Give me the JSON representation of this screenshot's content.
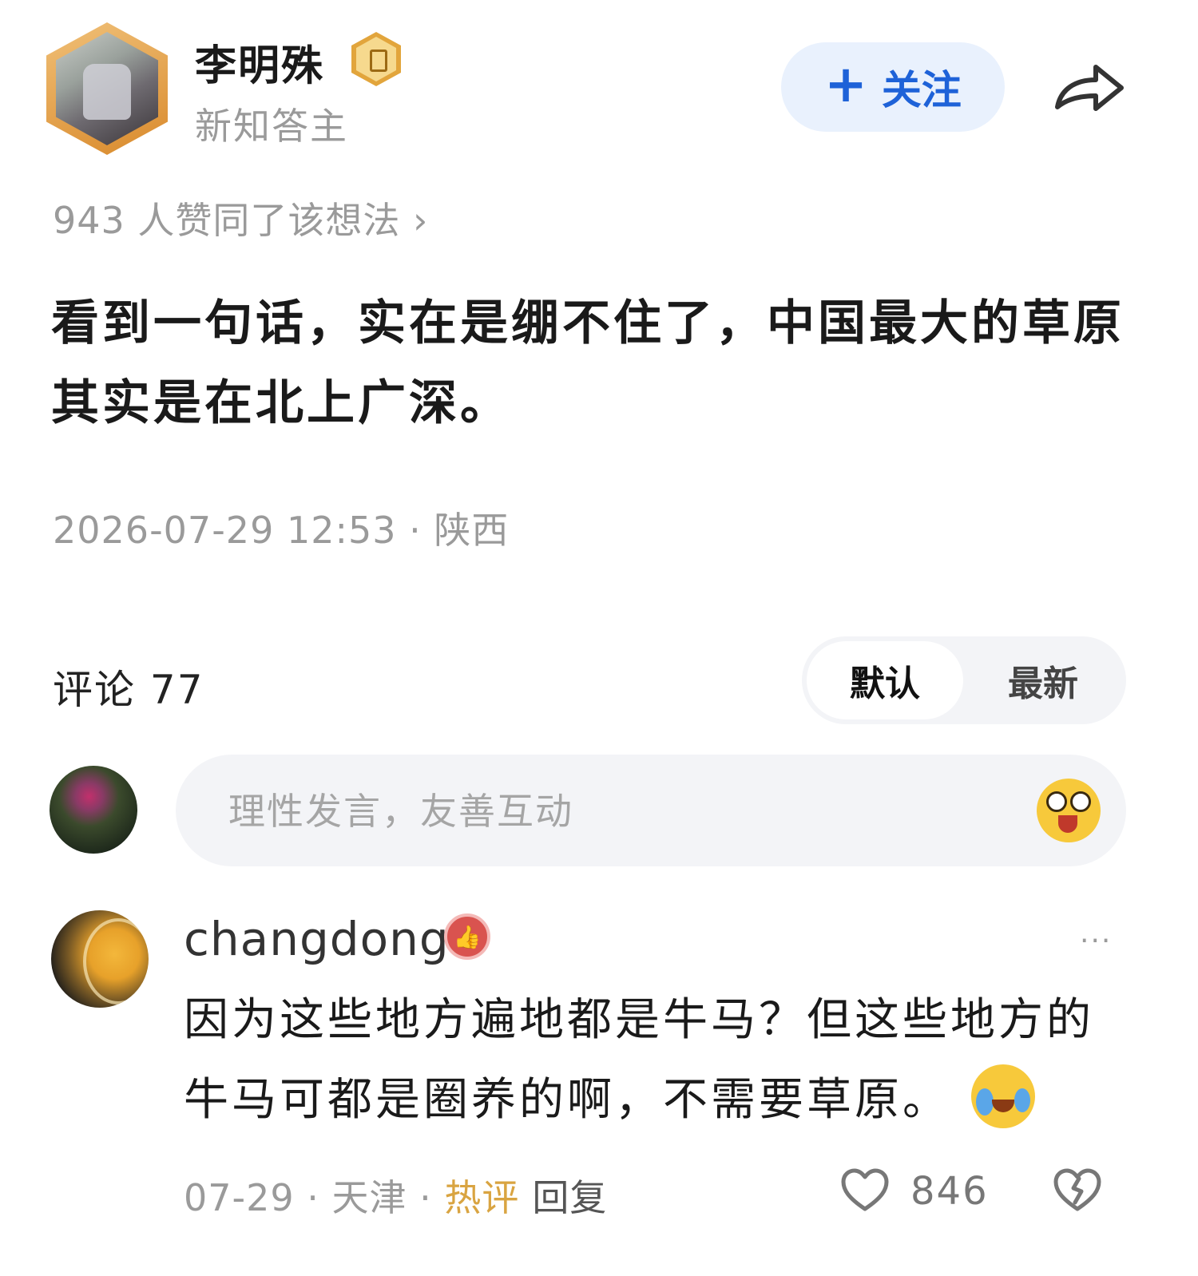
{
  "author": {
    "name": "李明殊",
    "subtitle": "新知答主"
  },
  "follow_button": {
    "plus": "+",
    "label": "关注"
  },
  "agree": {
    "text": "943 人赞同了该想法 ›"
  },
  "post": {
    "content": "看到一句话，实在是绷不住了，中国最大的草原其实是在北上广深。",
    "meta": "2026-07-29 12:53 · 陕西"
  },
  "comments_header": {
    "title": "评论 77",
    "sort_default": "默认",
    "sort_latest": "最新"
  },
  "comment_input": {
    "placeholder": "理性发言，友善互动"
  },
  "comment": {
    "username": "changdong",
    "more": "···",
    "text": "因为这些地方遍地都是牛马？但这些地方的牛马可都是圈养的啊，不需要草原。",
    "date": "07-29 · 天津 · ",
    "hot_label": "热评",
    "reply_label": "回复",
    "likes": "846"
  },
  "icons": {
    "share": "share-arrow-icon",
    "emoji": "emoji-face-icon",
    "like": "heart-outline-icon",
    "dislike": "broken-heart-icon"
  },
  "colors": {
    "accent": "#1e62d8",
    "follow_bg": "#e9f1fd",
    "hot": "#d9a441",
    "muted": "#9a9a9a"
  }
}
